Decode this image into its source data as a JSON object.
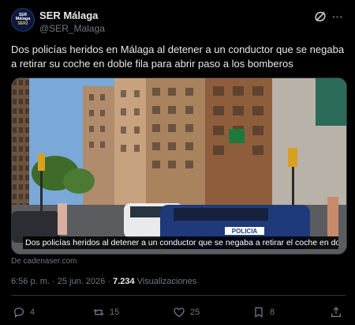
{
  "account": {
    "avatar_line1": "SER",
    "avatar_line2": "Málaga",
    "avatar_line3": "SER2",
    "name": "SER Málaga",
    "handle": "@SER_Malaga"
  },
  "tweet": {
    "text": "Dos policías heridos en Málaga al detener a un conductor que se negaba a retirar su coche en doble fila para abrir paso a los bomberos",
    "media_caption": "Dos policías heridos al detener a un conductor que se negaba a retirar el coche en dobl...",
    "police_label": "POLICIA",
    "source": "De cadenaser.com",
    "time": "6:56 p. m.",
    "date": "25 jun. 2026",
    "separator": "·",
    "views_count": "7.234",
    "views_label": "Visualizaciones"
  },
  "actions": {
    "reply_count": "4",
    "retweet_count": "15",
    "like_count": "25",
    "bookmark_count": "8"
  },
  "icons": {
    "grok": "grok-icon",
    "more": "more-icon",
    "reply": "reply-icon",
    "retweet": "retweet-icon",
    "like": "heart-icon",
    "bookmark": "bookmark-icon",
    "share": "share-icon"
  },
  "colors": {
    "background": "#000000",
    "text": "#e7e9ea",
    "muted": "#71767b",
    "divider": "#2f3336"
  }
}
